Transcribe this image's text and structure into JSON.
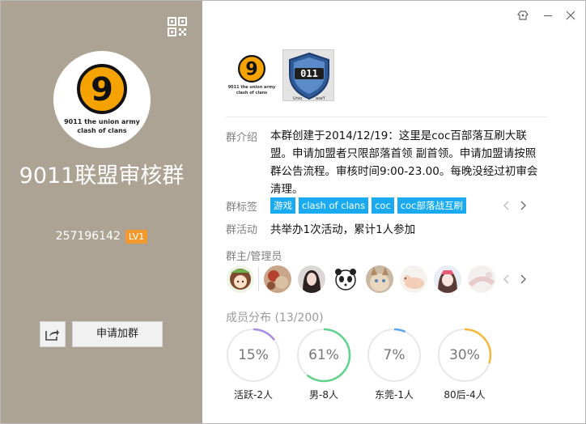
{
  "window": {
    "controls": {
      "skin_icon": "skin-icon",
      "min_icon": "minimize-icon",
      "close_icon": "close-icon"
    }
  },
  "left": {
    "bg_color": "#ada394",
    "logo": {
      "number": "9",
      "line1": "9011 the union army",
      "line2": "clash of clans"
    },
    "group_name": "9011联盟审核群",
    "group_id": "257196142",
    "level": "LV1",
    "join_button": "申请加群",
    "share_icon": "share-icon",
    "qr_icon": "qr-code-icon"
  },
  "main": {
    "thumb1": {
      "number": "9",
      "line1": "9011 the union army",
      "line2": "clash of clans"
    },
    "thumb2": {
      "text": "011",
      "caption_left": "Unio",
      "caption_right": "aseY"
    },
    "intro_label": "群介绍",
    "intro_text": "本群创建于2014/12/19：这里是coc百部落互刷大联盟。申请加盟者只限部落首领 副首领。申请加盟请按照群公告流程。审核时间9:00-23.00。每晚没经过初审会清理。",
    "tags_label": "群标签",
    "tags": [
      "游戏",
      "clash of clans",
      "coc",
      "coc部落战互刷"
    ],
    "activity_label": "群活动",
    "activity_text": "共举办1次活动，累计1人参加",
    "admins_label": "群主/管理员",
    "distribution_label": "成员分布 (13/200)",
    "distribution": [
      {
        "percent_text": "15%",
        "fraction": 0.15,
        "caption": "活跃-2人",
        "color": "#a98ee0"
      },
      {
        "percent_text": "61%",
        "fraction": 0.61,
        "caption": "男-8人",
        "color": "#5fd28c"
      },
      {
        "percent_text": "7%",
        "fraction": 0.07,
        "caption": "东莞-1人",
        "color": "#5aa5ec"
      },
      {
        "percent_text": "30%",
        "fraction": 0.3,
        "caption": "80后-4人",
        "color": "#f4b73a"
      }
    ]
  }
}
